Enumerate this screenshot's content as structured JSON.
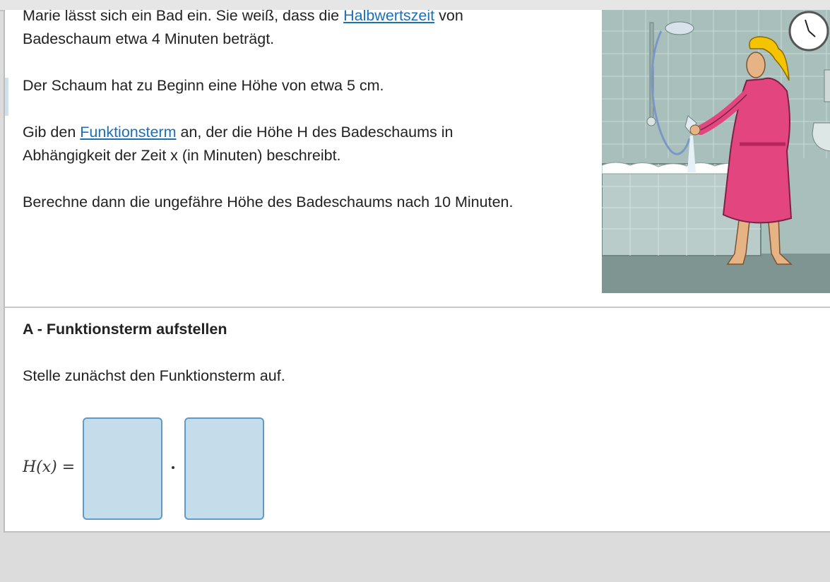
{
  "task": {
    "intro_line1_prefix": "Marie lässt sich ein Bad ein. Sie weiß, dass die ",
    "intro_link": "Halbwertszeit",
    "intro_line1_suffix": " von",
    "intro_line2": "Badeschaum etwa 4 Minuten beträgt.",
    "foam_start": "Der Schaum hat zu Beginn eine Höhe von etwa 5 cm.",
    "instruction_prefix": "Gib den ",
    "instruction_link": "Funktionsterm",
    "instruction_suffix": " an, der die Höhe H des Badeschaums in",
    "instruction_line2": "Abhängigkeit der Zeit x (in Minuten) beschreibt.",
    "compute": "Berechne dann die ungefähre Höhe des Badeschaums nach 10 Minuten."
  },
  "illustration": {
    "colors": {
      "wall": "#a9bfbb",
      "floor": "#7e9592",
      "bathtub": "#b9ccc9",
      "robe": "#e3457f",
      "hair": "#f5c400"
    }
  },
  "section_a": {
    "heading": "A - Funktionsterm aufstellen",
    "prompt": "Stelle zunächst den Funktionsterm auf.",
    "formula_label": "H(x) =",
    "multiply_symbol": "·",
    "inputs": [
      {
        "value": ""
      },
      {
        "value": ""
      }
    ]
  },
  "colors": {
    "link": "#1c6fb8",
    "input_fill": "#c5dceb",
    "input_border": "#5b9ccc"
  }
}
